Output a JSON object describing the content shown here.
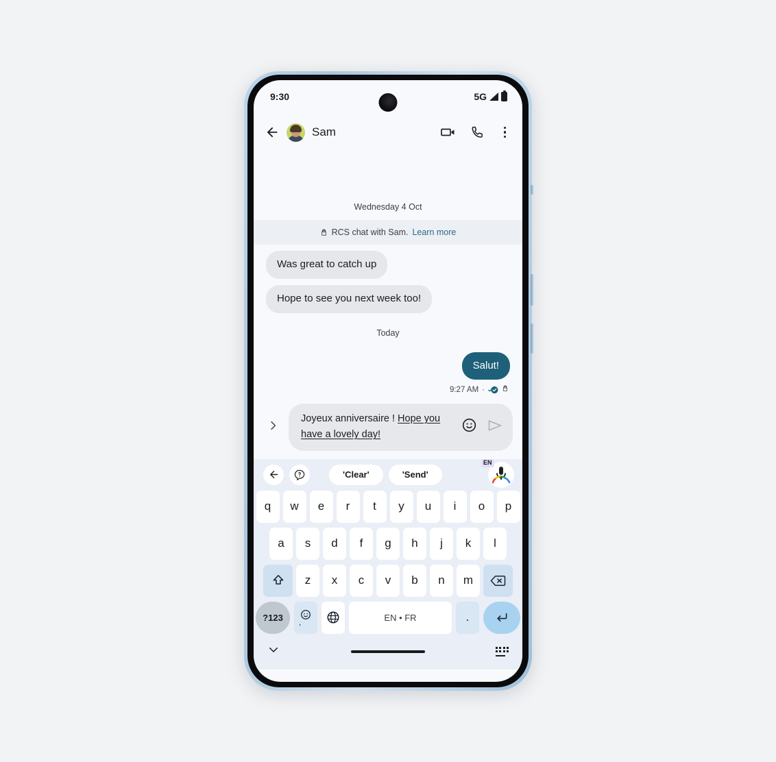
{
  "status_bar": {
    "time": "9:30",
    "network": "5G",
    "signal_icon": "signal-bars-icon",
    "battery_icon": "battery-full-icon"
  },
  "app_bar": {
    "back_icon": "back-arrow-icon",
    "avatar_name": "avatar",
    "contact_name": "Sam",
    "video_call_icon": "video-camera-icon",
    "voice_call_icon": "phone-icon",
    "overflow_icon": "more-vert-icon"
  },
  "conversation": {
    "date_separator_1": "Wednesday 4 Oct",
    "rcs_banner": {
      "lock_icon": "lock-icon",
      "text": "RCS chat with Sam.",
      "link": "Learn more"
    },
    "messages": [
      {
        "text": "Was great to catch up",
        "direction": "in"
      },
      {
        "text": "Hope to see you next week too!",
        "direction": "in"
      }
    ],
    "date_separator_2": "Today",
    "sent_message": {
      "text": "Salut!",
      "direction": "out",
      "timestamp": "9:27 AM",
      "separator": "·",
      "delivered_icon": "double-check-icon",
      "encryption_icon": "lock-icon"
    }
  },
  "compose": {
    "expand_icon": "chevron-right-icon",
    "text_plain": "Joyeux anniversaire ! ",
    "text_underlined": "Hope you have a lovely day!",
    "emoji_icon": "emoji-smiley-icon",
    "send_icon": "send-arrow-icon"
  },
  "keyboard": {
    "suggestion_bar": {
      "back_icon": "back-arrow-icon",
      "help_icon": "help-bubble-icon",
      "chips": [
        "'Clear'",
        "'Send'"
      ],
      "mic_icon": "microphone-icon",
      "mic_badge": "EN"
    },
    "row1": [
      "q",
      "w",
      "e",
      "r",
      "t",
      "y",
      "u",
      "i",
      "o",
      "p"
    ],
    "row2": [
      "a",
      "s",
      "d",
      "f",
      "g",
      "h",
      "j",
      "k",
      "l"
    ],
    "row3": [
      "z",
      "x",
      "c",
      "v",
      "b",
      "n",
      "m"
    ],
    "shift_icon": "shift-up-icon",
    "backspace_icon": "backspace-icon",
    "symbols_key": "?123",
    "emoji_key_icon": "emoji-smiley-icon",
    "emoji_key_comma": ",",
    "globe_icon": "globe-language-icon",
    "space_key": "EN • FR",
    "period_key": ".",
    "enter_icon": "enter-return-icon"
  },
  "nav_bar": {
    "hide_keyboard_icon": "chevron-down-icon",
    "gesture_pill": "gesture-home-pill",
    "keyboard_switch_icon": "keyboard-switch-icon"
  },
  "colors": {
    "page_background": "#f2f3f5",
    "screen_background": "#f7f9fc",
    "incoming_bubble": "#e5e7ea",
    "outgoing_bubble": "#1e6079",
    "link": "#2b6a8a",
    "keyboard_background": "#eaeef6",
    "key_white": "#ffffff",
    "key_accent": "#cfe0f0",
    "enter_key": "#a8d2f0",
    "symbols_key": "#bfc7cf",
    "mic_badge": "#e3ddf7",
    "phone_bezel": "#b5d2e8"
  }
}
